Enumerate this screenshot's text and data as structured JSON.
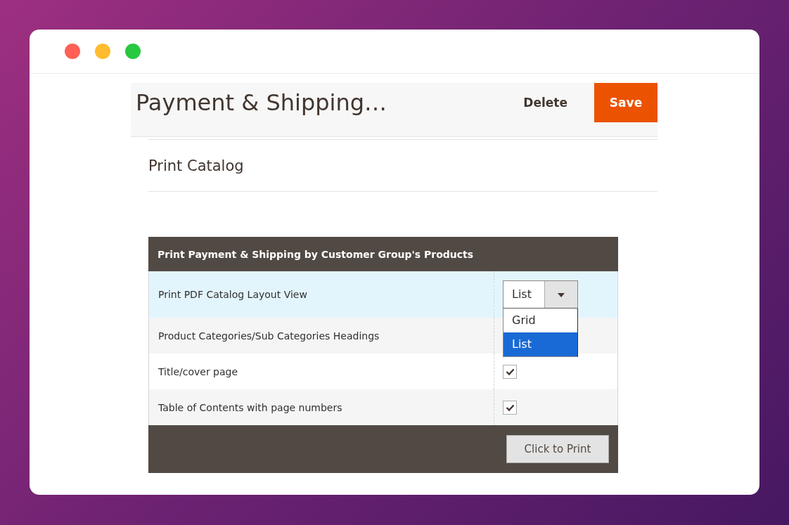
{
  "window": {
    "controls": [
      {
        "color": "#ff5f57"
      },
      {
        "color": "#febc2e"
      },
      {
        "color": "#28c840"
      }
    ]
  },
  "page_header": {
    "title": "Payment & Shipping…",
    "actions": [
      {
        "label": "Delete",
        "kind": "secondary"
      },
      {
        "label": "Save",
        "kind": "primary"
      }
    ]
  },
  "section": {
    "title": "Print Catalog"
  },
  "print_panel": {
    "title": "Print Payment & Shipping by Customer Group's Products",
    "rows": [
      {
        "label": "Print PDF Catalog Layout View",
        "kind": "select",
        "highlighted": true,
        "value": "List",
        "expanded": true,
        "options": [
          {
            "label": "Grid",
            "selected": false
          },
          {
            "label": "List",
            "selected": true
          }
        ]
      },
      {
        "label": "Product Categories/Sub Categories Headings",
        "kind": "text",
        "highlighted": false
      },
      {
        "label": "Title/cover page",
        "kind": "checkbox",
        "highlighted": false,
        "checked": true
      },
      {
        "label": "Table of Contents with page numbers",
        "kind": "checkbox",
        "highlighted": false,
        "checked": true
      }
    ],
    "print_button": "Click to Print"
  }
}
